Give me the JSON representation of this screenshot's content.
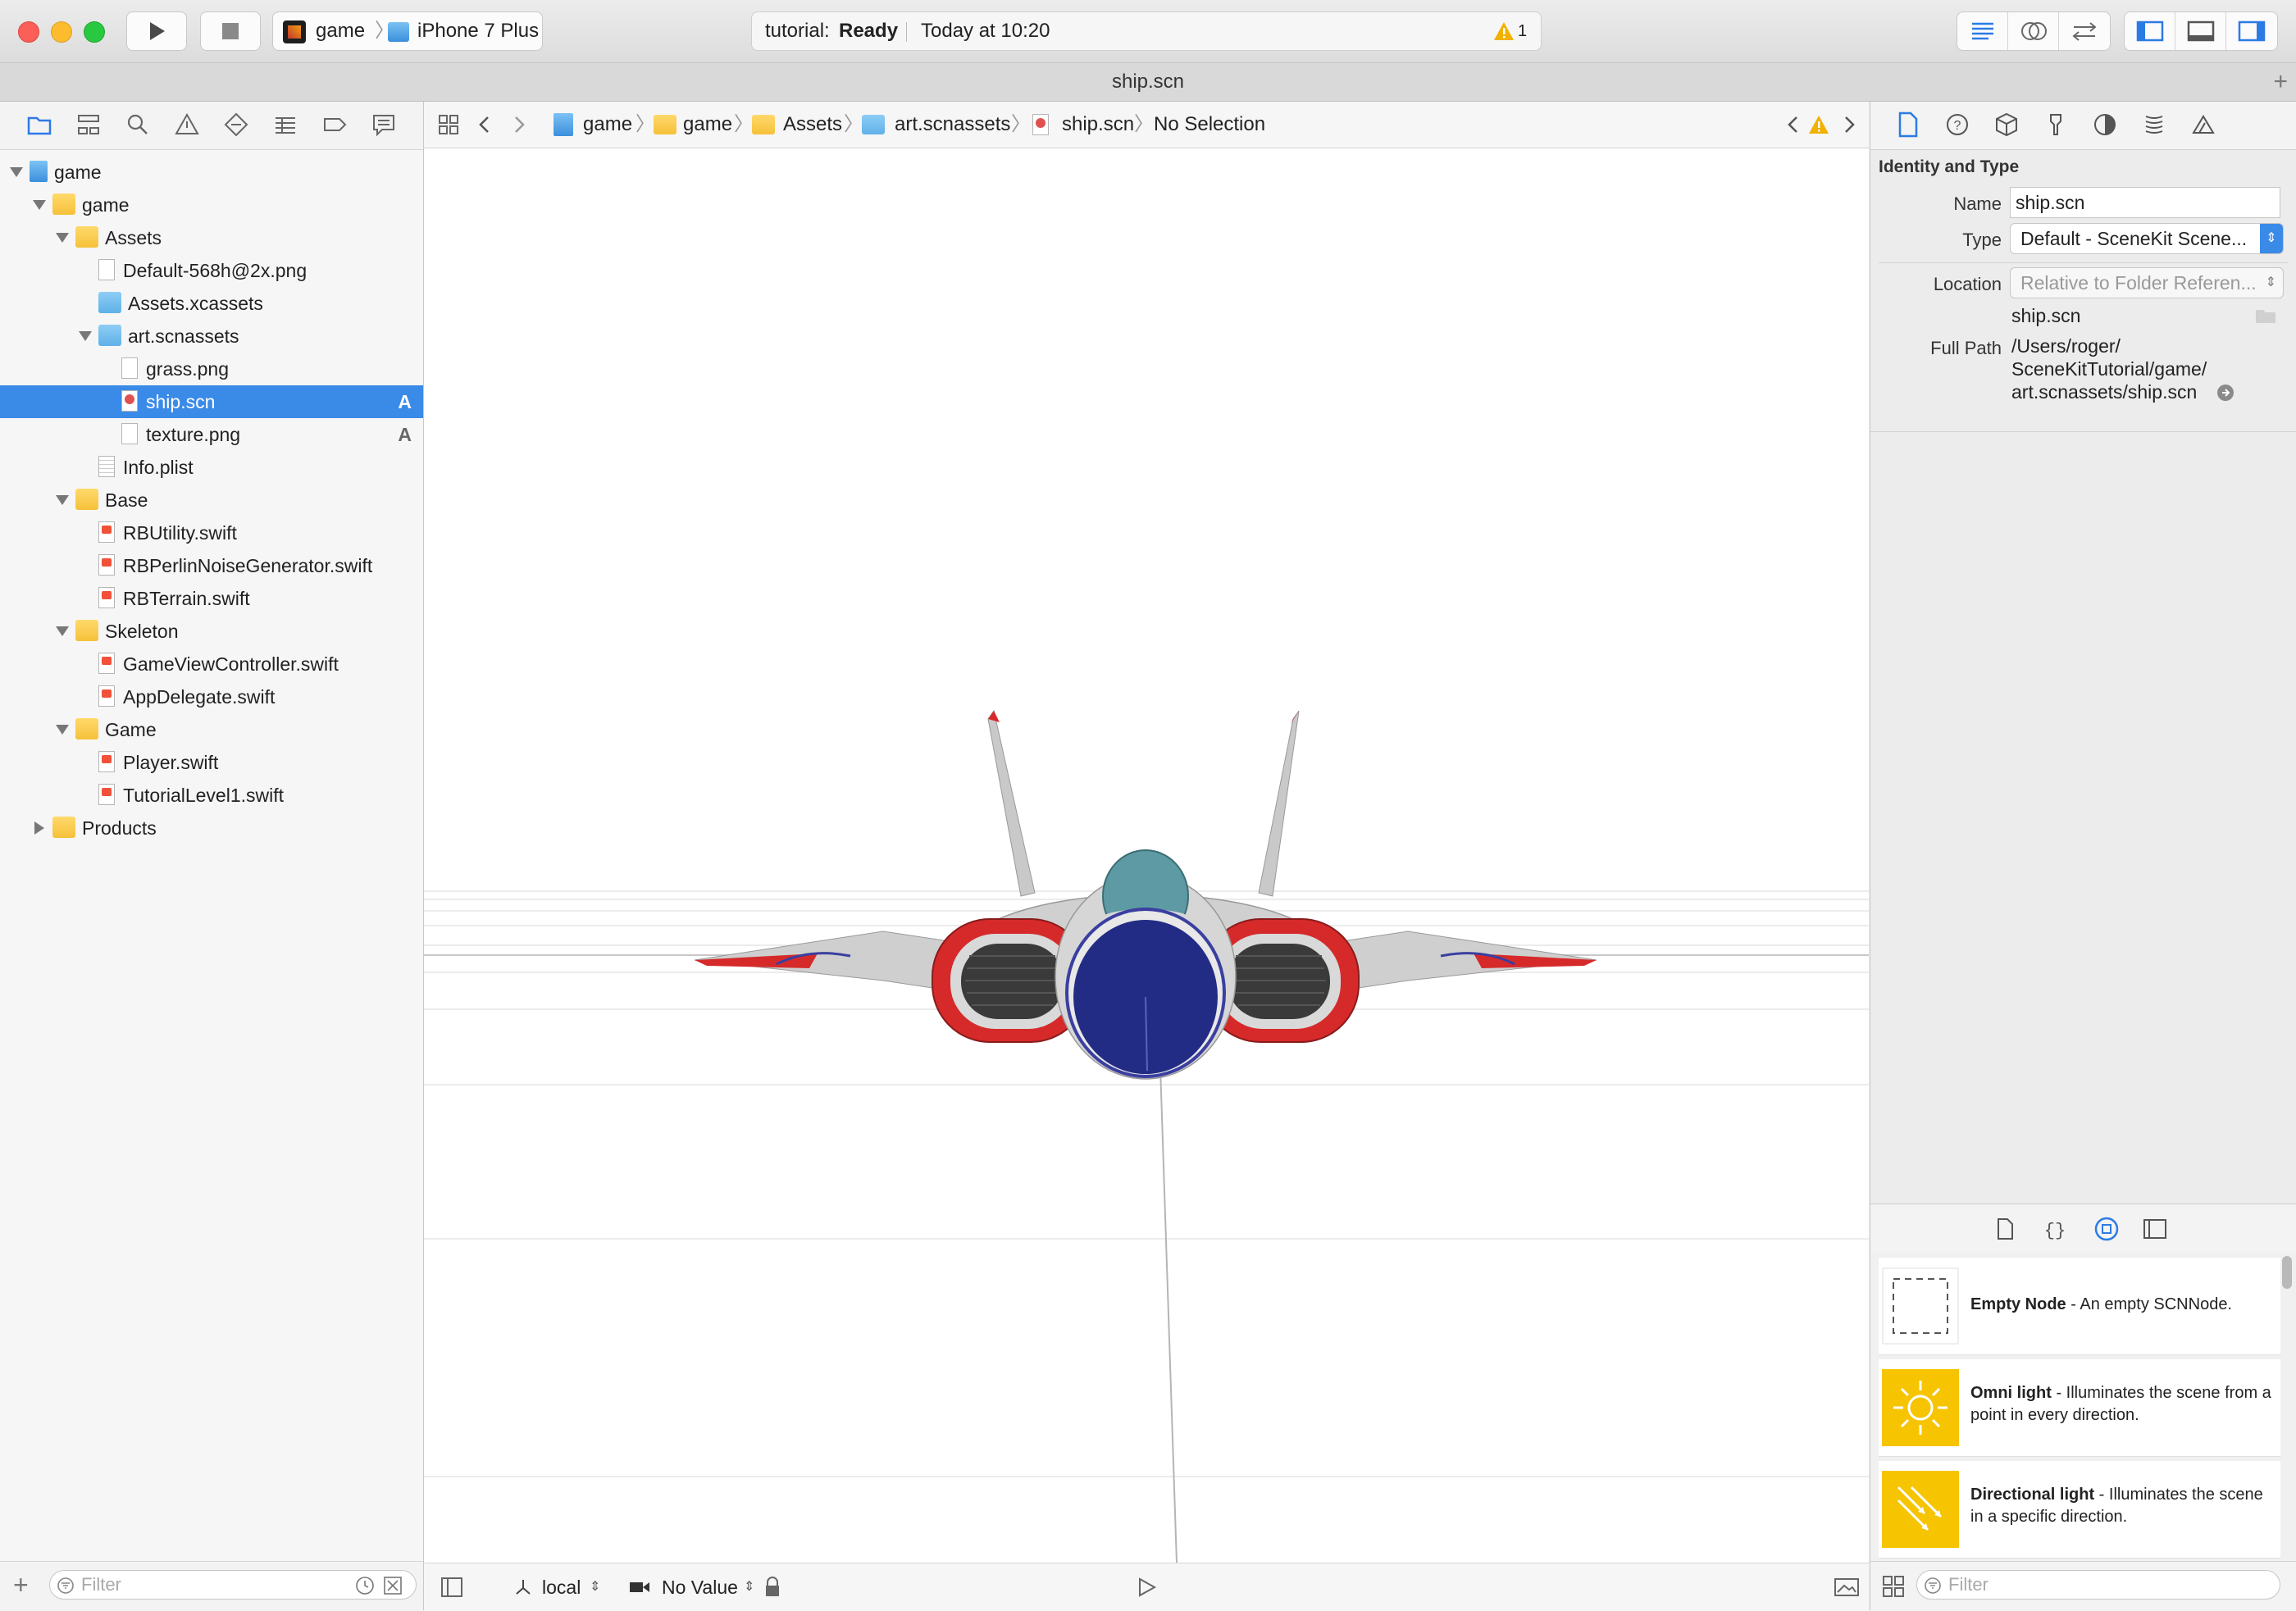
{
  "toolbar": {
    "scheme": "game",
    "device": "iPhone 7 Plus",
    "status_project": "tutorial:",
    "status_state": "Ready",
    "status_time": "Today at 10:20",
    "warning_count": "1"
  },
  "tab_title": "ship.scn",
  "navigator": {
    "tree": [
      {
        "label": "game",
        "depth": 0,
        "kind": "project",
        "open": true
      },
      {
        "label": "game",
        "depth": 1,
        "kind": "folder",
        "open": true
      },
      {
        "label": "Assets",
        "depth": 2,
        "kind": "folder",
        "open": true
      },
      {
        "label": "Default-568h@2x.png",
        "depth": 3,
        "kind": "png"
      },
      {
        "label": "Assets.xcassets",
        "depth": 3,
        "kind": "bluefolder"
      },
      {
        "label": "art.scnassets",
        "depth": 3,
        "kind": "bluefolder",
        "open": true
      },
      {
        "label": "grass.png",
        "depth": 4,
        "kind": "png"
      },
      {
        "label": "ship.scn",
        "depth": 4,
        "kind": "scn",
        "selected": true,
        "badge": "A"
      },
      {
        "label": "texture.png",
        "depth": 4,
        "kind": "png",
        "badge": "A"
      },
      {
        "label": "Info.plist",
        "depth": 3,
        "kind": "plist"
      },
      {
        "label": "Base",
        "depth": 2,
        "kind": "folder",
        "open": true
      },
      {
        "label": "RBUtility.swift",
        "depth": 3,
        "kind": "swift"
      },
      {
        "label": "RBPerlinNoiseGenerator.swift",
        "depth": 3,
        "kind": "swift"
      },
      {
        "label": "RBTerrain.swift",
        "depth": 3,
        "kind": "swift"
      },
      {
        "label": "Skeleton",
        "depth": 2,
        "kind": "folder",
        "open": true
      },
      {
        "label": "GameViewController.swift",
        "depth": 3,
        "kind": "swift"
      },
      {
        "label": "AppDelegate.swift",
        "depth": 3,
        "kind": "swift"
      },
      {
        "label": "Game",
        "depth": 2,
        "kind": "folder",
        "open": true
      },
      {
        "label": "Player.swift",
        "depth": 3,
        "kind": "swift"
      },
      {
        "label": "TutorialLevel1.swift",
        "depth": 3,
        "kind": "swift"
      },
      {
        "label": "Products",
        "depth": 1,
        "kind": "folder",
        "open": false
      }
    ],
    "filter_placeholder": "Filter"
  },
  "jumpbar": {
    "crumbs": [
      "game",
      "game",
      "Assets",
      "art.scnassets",
      "ship.scn",
      "No Selection"
    ]
  },
  "editor_bottom": {
    "coordinate_space": "local",
    "camera": "No Value"
  },
  "inspector": {
    "section_title": "Identity and Type",
    "name_label": "Name",
    "name_value": "ship.scn",
    "type_label": "Type",
    "type_value": "Default - SceneKit Scene...",
    "location_label": "Location",
    "location_value": "Relative to Folder Referen...",
    "location_file": "ship.scn",
    "fullpath_label": "Full Path",
    "fullpath_lines": [
      "/Users/roger/",
      "SceneKitTutorial/game/",
      "art.scnassets/ship.scn"
    ]
  },
  "library": {
    "items": [
      {
        "title": "Empty Node",
        "desc": " - An empty SCNNode.",
        "thumb": "empty-node-icon"
      },
      {
        "title": "Omni light",
        "desc": " - Illuminates the scene from a point in every direction.",
        "thumb": "omni-light-icon"
      },
      {
        "title": "Directional light",
        "desc": " - Illuminates the scene in a specific direction.",
        "thumb": "directional-light-icon"
      }
    ],
    "filter_placeholder": "Filter"
  },
  "colors": {
    "selection": "#3a8ae8",
    "ship_red": "#d62a2a",
    "ship_blue": "#232c85",
    "cockpit": "#5d9aa3",
    "light_yellow": "#f6c400",
    "warning": "#f2b100"
  }
}
